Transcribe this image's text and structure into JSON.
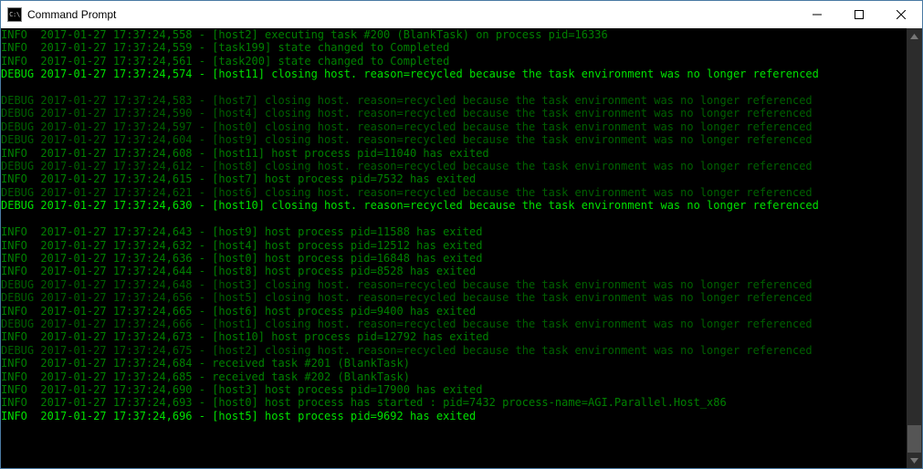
{
  "window": {
    "title": "Command Prompt",
    "icon_label": "C:\\"
  },
  "log": [
    {
      "level": "INFO ",
      "cls": "info",
      "ts": "2017-01-27 17:37:24,558",
      "msg": "[host2] executing task #200 (BlankTask) on process pid=16336"
    },
    {
      "level": "INFO ",
      "cls": "info",
      "ts": "2017-01-27 17:37:24,559",
      "msg": "[task199] state changed to Completed"
    },
    {
      "level": "INFO ",
      "cls": "info",
      "ts": "2017-01-27 17:37:24,561",
      "msg": "[task200] state changed to Completed"
    },
    {
      "level": "DEBUG",
      "cls": "bright",
      "ts": "2017-01-27 17:37:24,574",
      "msg": "[host11] closing host. reason=recycled because the task environment was no longer referenced"
    },
    {
      "level": "",
      "cls": "blank",
      "ts": "",
      "msg": ""
    },
    {
      "level": "DEBUG",
      "cls": "debug",
      "ts": "2017-01-27 17:37:24,583",
      "msg": "[host7] closing host. reason=recycled because the task environment was no longer referenced"
    },
    {
      "level": "DEBUG",
      "cls": "debug",
      "ts": "2017-01-27 17:37:24,590",
      "msg": "[host4] closing host. reason=recycled because the task environment was no longer referenced"
    },
    {
      "level": "DEBUG",
      "cls": "debug",
      "ts": "2017-01-27 17:37:24,597",
      "msg": "[host0] closing host. reason=recycled because the task environment was no longer referenced"
    },
    {
      "level": "DEBUG",
      "cls": "debug",
      "ts": "2017-01-27 17:37:24,604",
      "msg": "[host9] closing host. reason=recycled because the task environment was no longer referenced"
    },
    {
      "level": "INFO ",
      "cls": "info",
      "ts": "2017-01-27 17:37:24,608",
      "msg": "[host11] host process pid=11040 has exited"
    },
    {
      "level": "DEBUG",
      "cls": "debug",
      "ts": "2017-01-27 17:37:24,612",
      "msg": "[host8] closing host. reason=recycled because the task environment was no longer referenced"
    },
    {
      "level": "INFO ",
      "cls": "info",
      "ts": "2017-01-27 17:37:24,615",
      "msg": "[host7] host process pid=7532 has exited"
    },
    {
      "level": "DEBUG",
      "cls": "debug",
      "ts": "2017-01-27 17:37:24,621",
      "msg": "[host6] closing host. reason=recycled because the task environment was no longer referenced"
    },
    {
      "level": "DEBUG",
      "cls": "bright",
      "ts": "2017-01-27 17:37:24,630",
      "msg": "[host10] closing host. reason=recycled because the task environment was no longer referenced"
    },
    {
      "level": "",
      "cls": "blank",
      "ts": "",
      "msg": ""
    },
    {
      "level": "INFO ",
      "cls": "info",
      "ts": "2017-01-27 17:37:24,643",
      "msg": "[host9] host process pid=11588 has exited"
    },
    {
      "level": "INFO ",
      "cls": "info",
      "ts": "2017-01-27 17:37:24,632",
      "msg": "[host4] host process pid=12512 has exited"
    },
    {
      "level": "INFO ",
      "cls": "info",
      "ts": "2017-01-27 17:37:24,636",
      "msg": "[host0] host process pid=16848 has exited"
    },
    {
      "level": "INFO ",
      "cls": "info",
      "ts": "2017-01-27 17:37:24,644",
      "msg": "[host8] host process pid=8528 has exited"
    },
    {
      "level": "DEBUG",
      "cls": "debug",
      "ts": "2017-01-27 17:37:24,648",
      "msg": "[host3] closing host. reason=recycled because the task environment was no longer referenced"
    },
    {
      "level": "DEBUG",
      "cls": "debug",
      "ts": "2017-01-27 17:37:24,656",
      "msg": "[host5] closing host. reason=recycled because the task environment was no longer referenced"
    },
    {
      "level": "INFO ",
      "cls": "info",
      "ts": "2017-01-27 17:37:24,665",
      "msg": "[host6] host process pid=9400 has exited"
    },
    {
      "level": "DEBUG",
      "cls": "debug",
      "ts": "2017-01-27 17:37:24,666",
      "msg": "[host1] closing host. reason=recycled because the task environment was no longer referenced"
    },
    {
      "level": "INFO ",
      "cls": "info",
      "ts": "2017-01-27 17:37:24,673",
      "msg": "[host10] host process pid=12792 has exited"
    },
    {
      "level": "DEBUG",
      "cls": "debug",
      "ts": "2017-01-27 17:37:24,675",
      "msg": "[host2] closing host. reason=recycled because the task environment was no longer referenced"
    },
    {
      "level": "INFO ",
      "cls": "info",
      "ts": "2017-01-27 17:37:24,684",
      "msg": "received task #201 (BlankTask)"
    },
    {
      "level": "INFO ",
      "cls": "info",
      "ts": "2017-01-27 17:37:24,685",
      "msg": "received task #202 (BlankTask)"
    },
    {
      "level": "INFO ",
      "cls": "info",
      "ts": "2017-01-27 17:37:24,690",
      "msg": "[host3] host process pid=17900 has exited"
    },
    {
      "level": "INFO ",
      "cls": "info",
      "ts": "2017-01-27 17:37:24,693",
      "msg": "[host0] host process has started : pid=7432 process-name=AGI.Parallel.Host_x86"
    },
    {
      "level": "INFO ",
      "cls": "bright",
      "ts": "2017-01-27 17:37:24,696",
      "msg": "[host5] host process pid=9692 has exited"
    }
  ]
}
